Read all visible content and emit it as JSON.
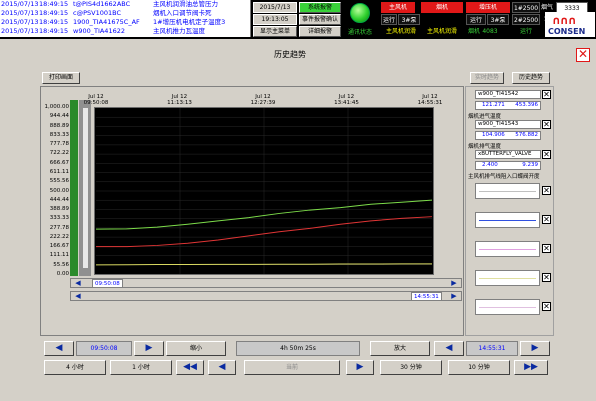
{
  "alarms": [
    {
      "date": "2015/07/13",
      "time": "18:49:15",
      "tag": "t@PIS4d1662ABC",
      "desc": "主风机润滑油总管压力"
    },
    {
      "date": "2015/07/13",
      "time": "18:49:15",
      "tag": "c@PSV1001BC",
      "desc": "烟机入口调节阀卡死"
    },
    {
      "date": "2015/07/13",
      "time": "18:49:15",
      "tag": "1900_TIA41675C_AF",
      "desc": "1#增压机电机定子温度3"
    },
    {
      "date": "2015/07/13",
      "time": "18:49:15",
      "tag": "w900_TIA41622",
      "desc": "主风机推力瓦温度"
    }
  ],
  "top": {
    "date": "2015/7/13",
    "time": "19:13:05",
    "btn_alarm": "系统报警",
    "btn_confirm": "事件报警确认",
    "btn_mainmenu": "显示主菜单",
    "btn_detail": "详细报警",
    "lamp_label": "通讯状态",
    "cells_row1": [
      "主风机",
      "烟机",
      "增压机",
      "1#2500"
    ],
    "cells_row2": [
      "运行",
      "3#泵",
      "运行",
      "3#泵",
      "2#2500"
    ],
    "cells_row3": [
      "主风机润滑",
      "主风机润滑",
      "烟机",
      "4083",
      "运行"
    ],
    "label_right": "烟气分",
    "value_right": "3333",
    "logo_text": "CONSEN"
  },
  "header": {
    "title": "历史趋势",
    "print_btn": "打印画面",
    "realtime_btn": "实时趋势",
    "history_btn": "历史趋势"
  },
  "trend": {
    "yticks": [
      "1,000.00",
      "944.44",
      "888.89",
      "833.33",
      "777.78",
      "722.22",
      "666.67",
      "611.11",
      "555.56",
      "500.00",
      "444.44",
      "388.89",
      "333.33",
      "277.78",
      "222.22",
      "166.67",
      "111.11",
      "55.56",
      "0.00"
    ],
    "xticks": [
      {
        "date": "Jul 12",
        "time": "09:50:08"
      },
      {
        "date": "Jul 12",
        "time": "11:13:13"
      },
      {
        "date": "Jul 12",
        "time": "12:27:39"
      },
      {
        "date": "Jul 12",
        "time": "13:41:45"
      },
      {
        "date": "Jul 12",
        "time": "14:55:31"
      }
    ],
    "scroll_left_time": "09:50:08",
    "scroll_right_time": "14:55:31"
  },
  "legend": {
    "items": [
      {
        "title": "",
        "tag": "w900_TI41542",
        "lo": "121.271",
        "hi": "453.396",
        "color": "#5aa55a"
      },
      {
        "title": "烟机进气温度",
        "tag": "w900_TI41543",
        "lo": "104.906",
        "hi": "576.882",
        "color": "#d03030"
      },
      {
        "title": "烟机排气温度",
        "tag": "xBUTTERFLY_VALVE",
        "lo": "2.400",
        "hi": "9.239",
        "color": "#c8c850"
      },
      {
        "title": "主风机排气线阻入口蝶阀开度",
        "tag": "",
        "lo": "",
        "hi": "",
        "color": "#c0c0c0"
      }
    ],
    "extra_line_colors": [
      "#3050e0",
      "#e0a0e0",
      "#e0e0a0",
      "#e0c0e0"
    ]
  },
  "chart_data": {
    "type": "line",
    "x_range": [
      "Jul 12 09:50:08",
      "Jul 12 14:55:31"
    ],
    "ylim": [
      0,
      1000
    ],
    "series": [
      {
        "name": "w900_TI41542",
        "values": [
          270,
          272,
          282,
          300,
          320,
          340,
          365,
          385,
          400,
          420,
          432,
          445
        ]
      },
      {
        "name": "w900_TI41543",
        "values": [
          165,
          165,
          172,
          185,
          205,
          230,
          255,
          275,
          300,
          320,
          335,
          345
        ]
      },
      {
        "name": "xBUTTERFLY_VALVE",
        "values": [
          55,
          56,
          57,
          57,
          58,
          58,
          59,
          59,
          60,
          60,
          61,
          61
        ]
      }
    ]
  },
  "controls": {
    "time_start": "09:50:08",
    "zoom_out": "缩小",
    "duration": "4h 50m 25s",
    "zoom_in": "放大",
    "time_end": "14:55:31",
    "btn_4h": "4 小时",
    "btn_1h": "1 小时",
    "btn_mid": "当前",
    "btn_30min": "30 分钟",
    "btn_10min": "10 分钟"
  }
}
